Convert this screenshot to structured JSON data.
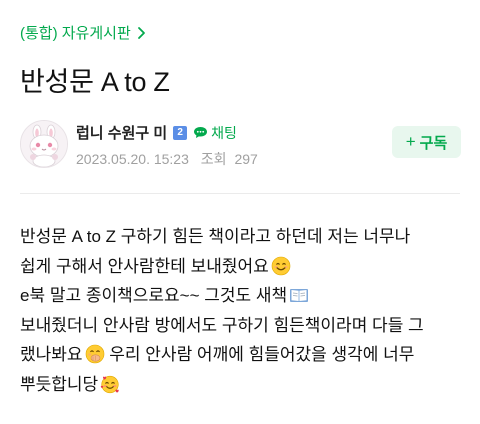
{
  "board": {
    "label": "(통합) 자유게시판",
    "chevron_icon": "chevron-right-icon"
  },
  "post": {
    "title": "반성문 A to Z"
  },
  "author": {
    "name": "럽니 수원구 미",
    "grade_badge": "2",
    "chat_label": "채팅",
    "avatar_icon": "bunny-avatar"
  },
  "meta": {
    "datetime": "2023.05.20. 15:23",
    "views_label": "조회",
    "views_count": "297"
  },
  "subscribe": {
    "label": "구독",
    "icon": "plus-icon"
  },
  "content": {
    "lines": [
      "반성문 A to Z 구하기 힘든 책이라고 하던데 저는 너무나",
      "쉽게 구해서 안사람한테 보내줬어요",
      "e북 말고 종이책으로요~~ 그것도 새책",
      "보내줬더니 안사람 방에서도 구하기 힘든책이라며 다들 그",
      "랬나봐요",
      " 우리 안사람 어깨에 힘들어갔을 생각에 너무",
      "뿌듯합니당"
    ],
    "emojis": [
      "smiling-face-icon",
      "open-book-icon",
      "face-with-hand-over-mouth-icon",
      "smiling-face-with-hearts-icon"
    ]
  },
  "colors": {
    "accent": "#03a94d",
    "subscribe_bg": "#e8f7ee",
    "meta_text": "#a0a0a0",
    "badge": "#5b8ee6"
  }
}
